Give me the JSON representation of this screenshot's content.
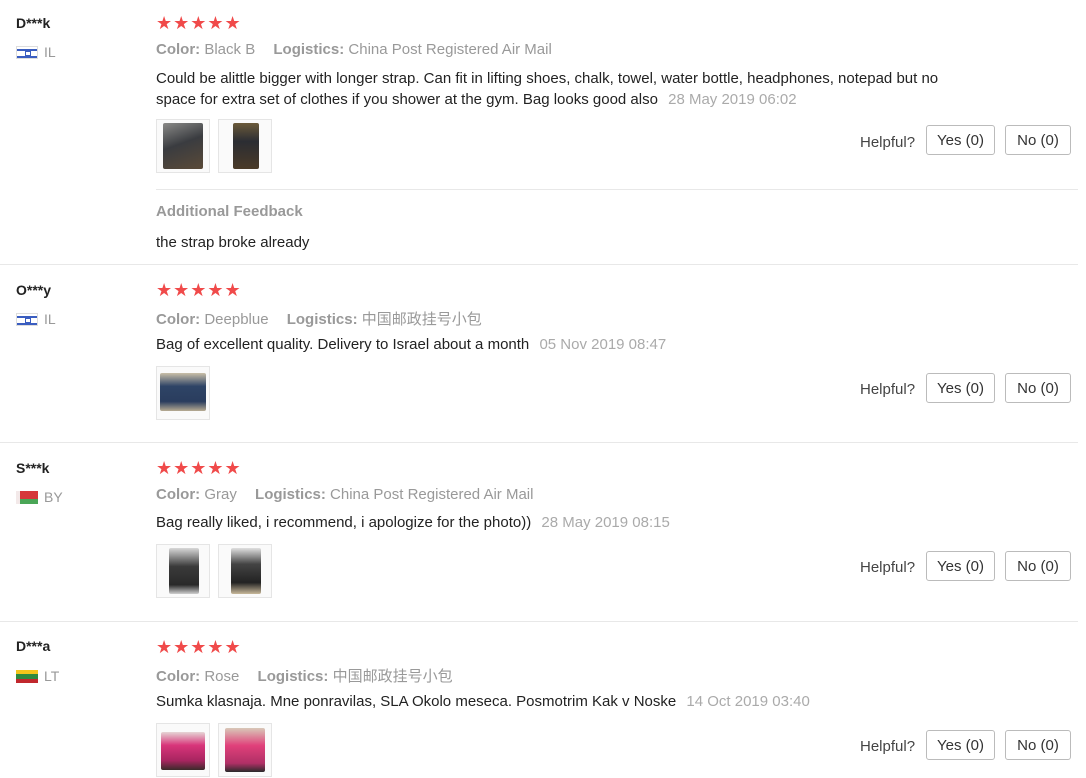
{
  "ui": {
    "helpful_label": "Helpful?",
    "color_label": "Color:",
    "logistics_label": "Logistics:",
    "stars": "★★★★★"
  },
  "reviews": [
    {
      "user": "D***k",
      "country": "IL",
      "color": "Black B",
      "logistics": "China Post Registered Air Mail",
      "text": "Could be alittle bigger with longer strap. Can fit in lifting shoes, chalk, towel, water bottle, headphones, notepad but no space for extra set of clothes if you shower at the gym. Bag looks good also",
      "date": "28 May 2019 06:02",
      "yes": "Yes (0)",
      "no": "No (0)",
      "additional_title": "Additional Feedback",
      "additional_text": "the strap broke already"
    },
    {
      "user": "O***y",
      "country": "IL",
      "color": "Deepblue",
      "logistics": "中国邮政挂号小包",
      "text": "Bag of excellent quality. Delivery to Israel about a month",
      "date": "05 Nov 2019 08:47",
      "yes": "Yes (0)",
      "no": "No (0)"
    },
    {
      "user": "S***k",
      "country": "BY",
      "color": "Gray",
      "logistics": "China Post Registered Air Mail",
      "text": "Bag really liked, i recommend, i apologize for the photo))",
      "date": "28 May 2019 08:15",
      "yes": "Yes (0)",
      "no": "No (0)"
    },
    {
      "user": "D***a",
      "country": "LT",
      "color": "Rose",
      "logistics": "中国邮政挂号小包",
      "text": "Sumka klasnaja. Mne ponravilas, SLA Okolo meseca. Posmotrim Kak v Noske",
      "date": "14 Oct 2019 03:40",
      "yes": "Yes (0)",
      "no": "No (0)"
    }
  ]
}
